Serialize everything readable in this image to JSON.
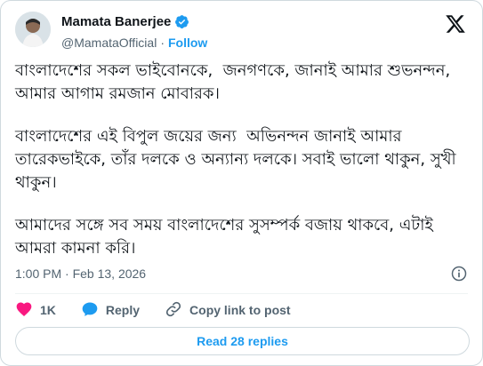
{
  "author": {
    "display_name": "Mamata Banerjee",
    "handle": "@MamataOfficial",
    "follow_label": "Follow",
    "verified_color": "#1d9bf0"
  },
  "tweet": {
    "paragraphs": [
      "বাংলাদেশের সকল ভাইবোনকে,  জনগণকে, জানাই আমার শুভনন্দন, আমার আগাম রমজান মোবারক।",
      "বাংলাদেশের এই বিপুল জয়ের জন্য  অভিনন্দন জানাই আমার তারেকভাইকে, তাঁর দলকে ও অন্যান্য দলকে। সবাই ভালো থাকুন, সুখী থাকুন।",
      "আমাদের সঙ্গে সব সময় বাংলাদেশের সুসম্পর্ক বজায় থাকবে, এটাই আমরা কামনা করি।"
    ],
    "timestamp": "1:00 PM · Feb 13, 2026"
  },
  "actions": {
    "like_count": "1K",
    "reply_label": "Reply",
    "copy_link_label": "Copy link to post"
  },
  "replies_button": "Read 28 replies",
  "colors": {
    "accent": "#1d9bf0",
    "like": "#f91880",
    "secondary_text": "#536471",
    "border": "#cfd9de"
  },
  "icons": [
    "verified-badge-icon",
    "x-logo-icon",
    "info-icon",
    "heart-icon",
    "reply-bubble-icon",
    "link-icon"
  ]
}
